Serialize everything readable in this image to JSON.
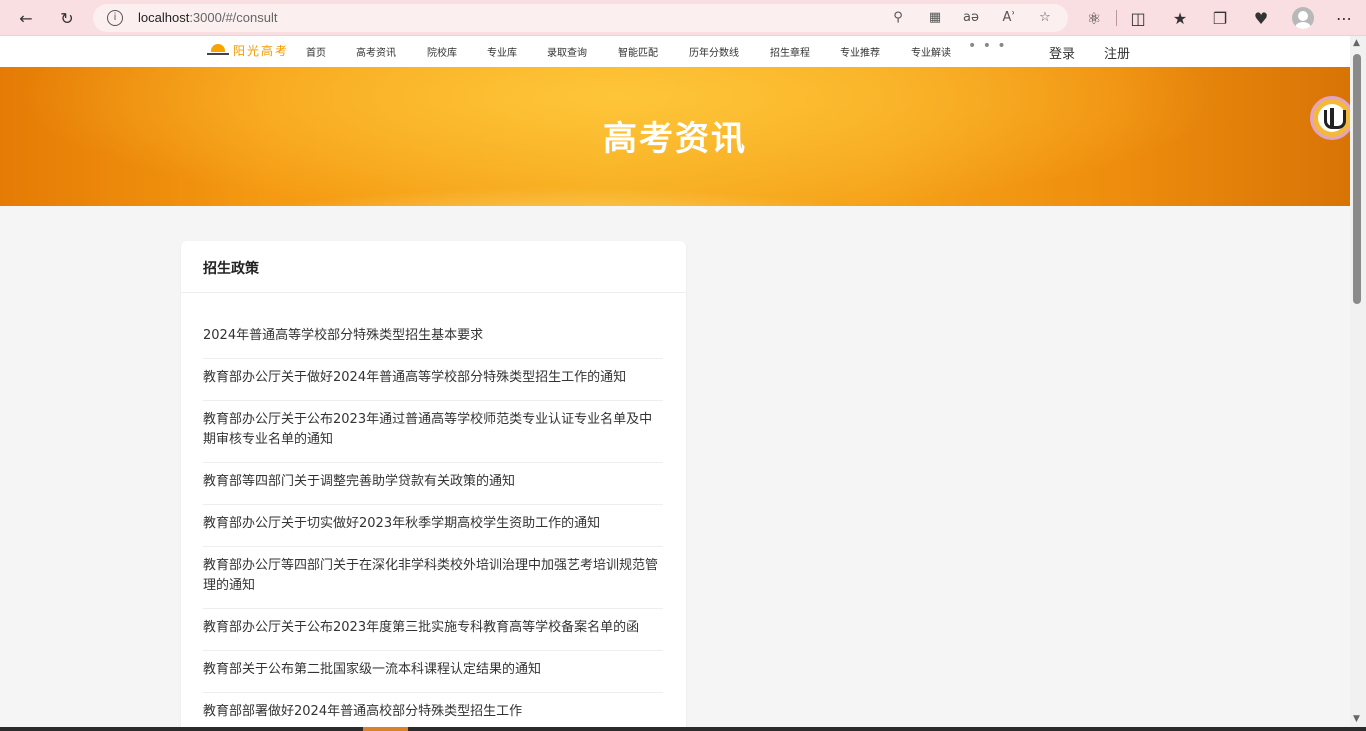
{
  "browser": {
    "url_host": "localhost",
    "url_rest": ":3000/#/consult",
    "icons": [
      "back-icon",
      "refresh-icon",
      "info-icon",
      "key-icon",
      "apps-icon",
      "translate-icon",
      "read-aloud-icon",
      "favorite-icon",
      "extensions-icon",
      "split-screen-icon",
      "favorites-icon",
      "collections-icon",
      "browser-essentials-icon",
      "profile-icon",
      "more-icon"
    ]
  },
  "nav": {
    "logo": "阳光高考",
    "items": [
      "首页",
      "高考资讯",
      "院校库",
      "专业库",
      "录取查询",
      "智能匹配",
      "历年分数线",
      "招生章程",
      "专业推荐",
      "专业解读"
    ],
    "more": "• • •",
    "login": "登录",
    "register": "注册"
  },
  "banner": {
    "title": "高考资讯"
  },
  "policy": {
    "title": "招生政策",
    "items": [
      "2024年普通高等学校部分特殊类型招生基本要求",
      "教育部办公厅关于做好2024年普通高等学校部分特殊类型招生工作的通知",
      "教育部办公厅关于公布2023年通过普通高等学校师范类专业认证专业名单及中期审核专业名单的通知",
      "教育部等四部门关于调整完善助学贷款有关政策的通知",
      "教育部办公厅关于切实做好2023年秋季学期高校学生资助工作的通知",
      "教育部办公厅等四部门关于在深化非学科类校外培训治理中加强艺考培训规范管理的通知",
      "教育部办公厅关于公布2023年度第三批实施专科教育高等学校备案名单的函",
      "教育部关于公布第二批国家级一流本科课程认定结果的通知",
      "教育部部署做好2024年普通高校部分特殊类型招生工作"
    ]
  },
  "colors": {
    "accent": "#f29b00",
    "browser_bar": "#f9dfe2"
  }
}
